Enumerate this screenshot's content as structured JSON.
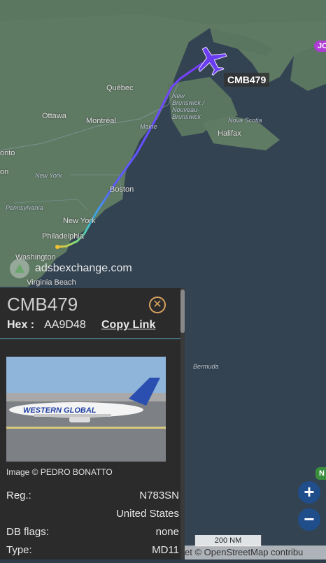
{
  "map": {
    "labels": {
      "quebec": "Québec",
      "ottawa": "Ottawa",
      "montreal": "Montréal",
      "maine": "Maine",
      "new_brunswick": "New Brunswick / Nouveau-Brunswick",
      "nova_scotia": "Nova Scotia",
      "halifax": "Halifax",
      "toronto_partial": "onto",
      "new_york_state": "New York",
      "boston": "Boston",
      "pennsylvania": "Pennsylvania",
      "new_york": "New York",
      "philadelphia": "Philadelphia",
      "washington": "Washington",
      "virginia_beach": "Virginia Beach",
      "bermuda": "Bermuda",
      "left_partial": "on"
    },
    "colors": {
      "land": "#5e7a63",
      "water": "#334352",
      "track_start": "#f1c232",
      "track_end": "#7a3cff"
    }
  },
  "flight_label": "CMB479",
  "jc_badge": "JC",
  "watermark": "adsbexchange.com",
  "panel": {
    "callsign": "CMB479",
    "hex_label": "Hex :",
    "hex_value": "AA9D48",
    "copy_link": "Copy Link",
    "close_icon": "close-icon",
    "photo_credit": "Image © PEDRO BONATTO",
    "photo_text": "WESTERN GLOBAL",
    "rows": [
      {
        "label": "Reg.:",
        "value": "N783SN"
      },
      {
        "label": "",
        "value": "United States"
      },
      {
        "label": "DB flags:",
        "value": "none"
      },
      {
        "label": "Type:",
        "value": "MD11"
      }
    ]
  },
  "controls": {
    "zoom_in": "+",
    "zoom_out": "−",
    "n_badge": "N",
    "scale": "200 NM",
    "attribution": "et © OpenStreetMap contribu"
  }
}
